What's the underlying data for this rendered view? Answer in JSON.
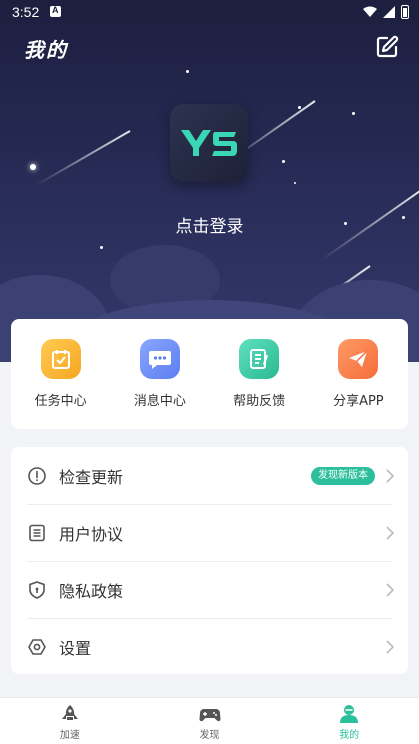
{
  "status_bar": {
    "time": "3:52"
  },
  "header": {
    "title": "我的"
  },
  "profile": {
    "login_text": "点击登录"
  },
  "quick_actions": [
    {
      "label": "任务中心",
      "icon": "task-icon",
      "color": "#f7b23b"
    },
    {
      "label": "消息中心",
      "icon": "message-icon",
      "color": "#6d8ff3"
    },
    {
      "label": "帮助反馈",
      "icon": "feedback-icon",
      "color": "#36c9a2"
    },
    {
      "label": "分享APP",
      "icon": "share-icon",
      "color": "#f57a45"
    }
  ],
  "menu": {
    "items": [
      {
        "label": "检查更新",
        "icon": "alert-circle-icon",
        "badge": "发现新版本"
      },
      {
        "label": "用户协议",
        "icon": "document-icon"
      },
      {
        "label": "隐私政策",
        "icon": "shield-icon"
      },
      {
        "label": "设置",
        "icon": "settings-icon"
      }
    ]
  },
  "bottom_nav": {
    "items": [
      {
        "label": "加速",
        "icon": "rocket-icon"
      },
      {
        "label": "发现",
        "icon": "gamepad-icon"
      },
      {
        "label": "我的",
        "icon": "profile-icon",
        "active": true
      }
    ]
  },
  "colors": {
    "accent": "#2bbf9b",
    "hero_dark": "#1d1f3f",
    "hero_light": "#35396c"
  }
}
